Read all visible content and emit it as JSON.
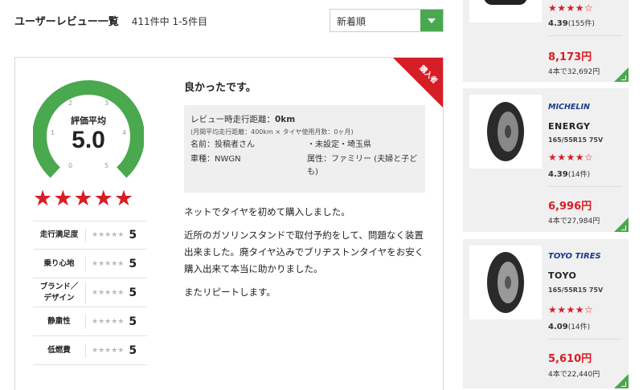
{
  "header": {
    "title": "ユーザーレビュー一覧",
    "count": "411件中 1-5件目"
  },
  "sort": {
    "selected": "新着順"
  },
  "review": {
    "badge": "購入者",
    "overall_label": "評価平均",
    "overall_score": "5.0",
    "gauge_ticks": [
      "0",
      "1",
      "2",
      "3",
      "4",
      "5"
    ],
    "overall_stars": "★★★★★",
    "scores": [
      {
        "name": "走行満足度",
        "stars": "★★★★★",
        "value": "5"
      },
      {
        "name": "乗り心地",
        "stars": "★★★★★",
        "value": "5"
      },
      {
        "name": "ブランド／デザイン",
        "stars": "★★★★★",
        "value": "5"
      },
      {
        "name": "静粛性",
        "stars": "★★★★★",
        "value": "5"
      },
      {
        "name": "低燃費",
        "stars": "★★★★★",
        "value": "5"
      }
    ],
    "title": "良かったです。",
    "distance_label": "レビュー時走行距離：",
    "distance_value": "0km",
    "monthly": "(月間平均走行距離：400km × タイヤ使用月数：0ヶ月)",
    "name": "名前：投稿者さん",
    "region": "・未設定・埼玉県",
    "car": "車種：NWGN",
    "attribute": "属性：ファミリー (夫婦と子ども)",
    "body": [
      "ネットでタイヤを初めて購入しました。",
      "近所のガソリンスタンドで取付予約をして、問題なく装置出来ました。廃タイヤ込みでブリヂストンタイヤをお安く購入出来て本当に助かりました。",
      "またリピートします。"
    ]
  },
  "products": [
    {
      "stars": "★★★★☆",
      "score": "4.39",
      "reviews": "(155件)",
      "price": "8,173円",
      "set_price": "4本で32,692円"
    },
    {
      "brand": "MICHELIN",
      "name": "ENERGY",
      "size": "165/55R15 75V",
      "stars": "★★★★☆",
      "score": "4.39",
      "reviews": "(14件)",
      "price": "6,996円",
      "set_price": "4本で27,984円"
    },
    {
      "brand": "TOYO TIRES",
      "name": "TOYO",
      "size": "165/55R15 75V",
      "stars": "★★★★☆",
      "score": "4.09",
      "reviews": "(14件)",
      "price": "5,610円",
      "set_price": "4本で22,440円"
    }
  ],
  "colors": {
    "accent_green": "#4aa84f",
    "accent_red": "#d71d26"
  }
}
